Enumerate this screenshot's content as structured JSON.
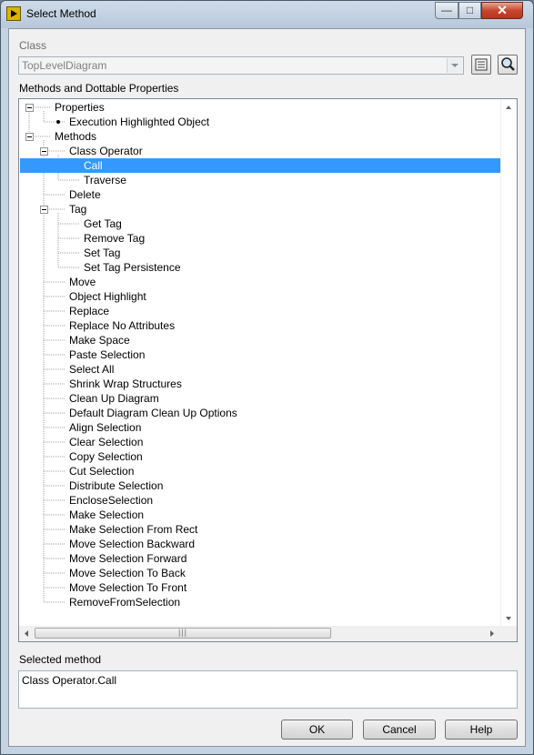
{
  "window": {
    "title": "Select Method",
    "controls": {
      "minimize": "—",
      "maximize": "□",
      "close": "✕"
    }
  },
  "class_section": {
    "label": "Class",
    "value": "TopLevelDiagram"
  },
  "tree": {
    "label": "Methods and Dottable Properties",
    "nodes": [
      {
        "text": "Properties",
        "level": 1,
        "type": "expanded"
      },
      {
        "text": "Execution Highlighted Object",
        "level": 2,
        "type": "bullet"
      },
      {
        "text": "Methods",
        "level": 1,
        "type": "expanded"
      },
      {
        "text": "Class Operator",
        "level": 2,
        "type": "expanded"
      },
      {
        "text": "Call",
        "level": 3,
        "type": "leaf",
        "selected": true
      },
      {
        "text": "Traverse",
        "level": 3,
        "type": "leaf"
      },
      {
        "text": "Delete",
        "level": 2,
        "type": "leaf"
      },
      {
        "text": "Tag",
        "level": 2,
        "type": "expanded"
      },
      {
        "text": "Get Tag",
        "level": 3,
        "type": "leaf"
      },
      {
        "text": "Remove Tag",
        "level": 3,
        "type": "leaf"
      },
      {
        "text": "Set Tag",
        "level": 3,
        "type": "leaf"
      },
      {
        "text": "Set Tag Persistence",
        "level": 3,
        "type": "leaf"
      },
      {
        "text": "Move",
        "level": 2,
        "type": "leaf"
      },
      {
        "text": "Object Highlight",
        "level": 2,
        "type": "leaf"
      },
      {
        "text": "Replace",
        "level": 2,
        "type": "leaf"
      },
      {
        "text": "Replace No Attributes",
        "level": 2,
        "type": "leaf"
      },
      {
        "text": "Make Space",
        "level": 2,
        "type": "leaf"
      },
      {
        "text": "Paste Selection",
        "level": 2,
        "type": "leaf"
      },
      {
        "text": "Select All",
        "level": 2,
        "type": "leaf"
      },
      {
        "text": "Shrink Wrap Structures",
        "level": 2,
        "type": "leaf"
      },
      {
        "text": "Clean Up Diagram",
        "level": 2,
        "type": "leaf"
      },
      {
        "text": "Default Diagram Clean Up Options",
        "level": 2,
        "type": "leaf"
      },
      {
        "text": "Align Selection",
        "level": 2,
        "type": "leaf"
      },
      {
        "text": "Clear Selection",
        "level": 2,
        "type": "leaf"
      },
      {
        "text": "Copy Selection",
        "level": 2,
        "type": "leaf"
      },
      {
        "text": "Cut Selection",
        "level": 2,
        "type": "leaf"
      },
      {
        "text": "Distribute Selection",
        "level": 2,
        "type": "leaf"
      },
      {
        "text": "EncloseSelection",
        "level": 2,
        "type": "leaf"
      },
      {
        "text": "Make Selection",
        "level": 2,
        "type": "leaf"
      },
      {
        "text": "Make Selection From Rect",
        "level": 2,
        "type": "leaf"
      },
      {
        "text": "Move Selection Backward",
        "level": 2,
        "type": "leaf"
      },
      {
        "text": "Move Selection Forward",
        "level": 2,
        "type": "leaf"
      },
      {
        "text": "Move Selection To Back",
        "level": 2,
        "type": "leaf"
      },
      {
        "text": "Move Selection To Front",
        "level": 2,
        "type": "leaf"
      },
      {
        "text": "RemoveFromSelection",
        "level": 2,
        "type": "leaf"
      }
    ]
  },
  "selected_method": {
    "label": "Selected method",
    "value": "Class Operator.Call"
  },
  "buttons": {
    "ok": "OK",
    "cancel": "Cancel",
    "help": "Help"
  },
  "colors": {
    "selection": "#3399ff",
    "title_bar": "#c4d2e2"
  }
}
